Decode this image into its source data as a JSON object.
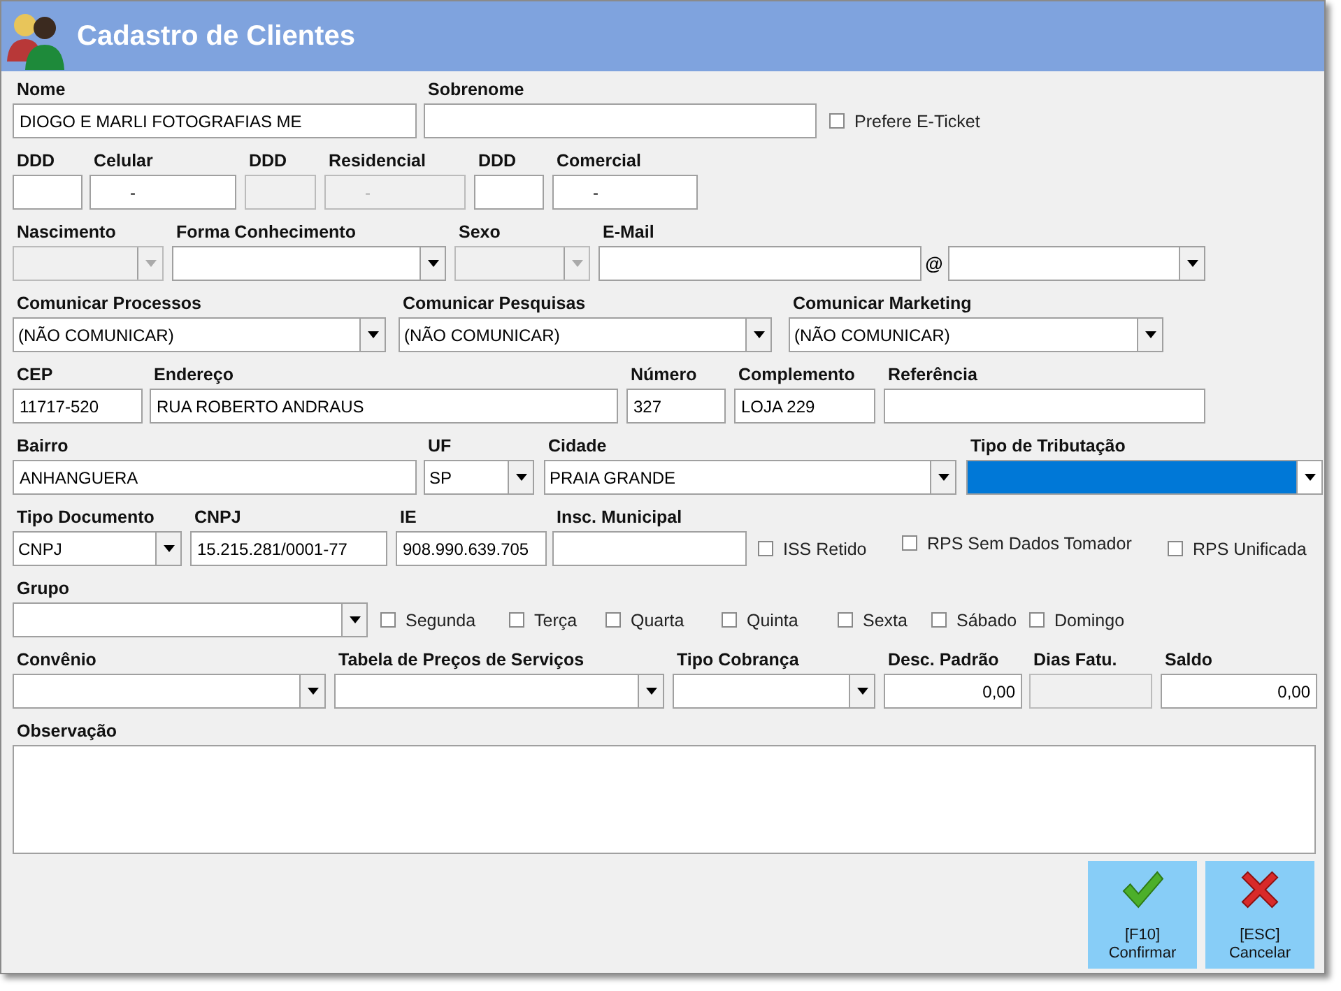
{
  "window": {
    "title": "Cadastro de Clientes"
  },
  "rows": [
    {
      "fields": [
        {
          "kind": "text",
          "label": "Nome",
          "value": "DIOGO E MARLI FOTOGRAFIAS ME",
          "disabled": false
        },
        {
          "kind": "text",
          "label": "Sobrenome",
          "disabled": false
        },
        {
          "kind": "check",
          "label": "Prefere E-Ticket",
          "checked": false
        }
      ]
    },
    {
      "fields": [
        {
          "kind": "text",
          "label": "DDD",
          "disabled": false
        },
        {
          "kind": "text",
          "label": "Celular",
          "value": "-",
          "disabled": false
        },
        {
          "kind": "text",
          "label": "DDD",
          "disabled": true
        },
        {
          "kind": "text",
          "label": "Residencial",
          "value": "-",
          "disabled": true
        },
        {
          "kind": "text",
          "label": "DDD",
          "disabled": false
        },
        {
          "kind": "text",
          "label": "Comercial",
          "value": "-",
          "disabled": false
        }
      ]
    },
    {
      "fields": [
        {
          "kind": "combo",
          "label": "Nascimento",
          "disabled": true,
          "highlighted": false
        },
        {
          "kind": "combo",
          "label": "Forma Conhecimento",
          "disabled": false,
          "highlighted": false
        },
        {
          "kind": "combo",
          "label": "Sexo",
          "disabled": true,
          "highlighted": false
        },
        {
          "kind": "text",
          "label": "E-Mail",
          "disabled": false
        },
        {
          "kind": "at",
          "label": "@"
        },
        {
          "kind": "combo",
          "disabled": false,
          "highlighted": false
        }
      ]
    },
    {
      "fields": [
        {
          "kind": "combo",
          "label": "Comunicar Processos",
          "value": "(NÃO COMUNICAR)",
          "disabled": false,
          "highlighted": false
        },
        {
          "kind": "combo",
          "label": "Comunicar Pesquisas",
          "value": "(NÃO COMUNICAR)",
          "disabled": false,
          "highlighted": false
        },
        {
          "kind": "combo",
          "label": "Comunicar Marketing",
          "value": "(NÃO COMUNICAR)",
          "disabled": false,
          "highlighted": false
        }
      ]
    },
    {
      "fields": [
        {
          "kind": "text",
          "label": "CEP",
          "value": "11717-520",
          "disabled": false
        },
        {
          "kind": "text",
          "label": "Endereço",
          "value": "RUA ROBERTO ANDRAUS",
          "disabled": false
        },
        {
          "kind": "text",
          "label": "Número",
          "value": "327",
          "disabled": false
        },
        {
          "kind": "text",
          "label": "Complemento",
          "value": "LOJA 229",
          "disabled": false
        },
        {
          "kind": "text",
          "label": "Referência",
          "disabled": false
        }
      ]
    },
    {
      "fields": [
        {
          "kind": "text",
          "label": "Bairro",
          "value": "ANHANGUERA",
          "disabled": false
        },
        {
          "kind": "combo",
          "label": "UF",
          "value": "SP",
          "disabled": false,
          "highlighted": false
        },
        {
          "kind": "combo",
          "label": "Cidade",
          "value": "PRAIA GRANDE",
          "disabled": false,
          "highlighted": false
        },
        {
          "kind": "combo",
          "label": "Tipo de Tributação",
          "disabled": false,
          "highlighted": true
        }
      ]
    },
    {
      "fields": [
        {
          "kind": "combo",
          "label": "Tipo Documento",
          "value": "CNPJ",
          "disabled": false,
          "highlighted": false
        },
        {
          "kind": "text",
          "label": "CNPJ",
          "value": "15.215.281/0001-77",
          "disabled": false
        },
        {
          "kind": "text",
          "label": "IE",
          "value": "908.990.639.705",
          "disabled": false
        },
        {
          "kind": "text",
          "label": "Insc. Municipal",
          "disabled": false
        },
        {
          "kind": "check",
          "label": "ISS Retido",
          "checked": false
        },
        {
          "kind": "check",
          "label": "RPS Sem Dados Tomador",
          "checked": false
        },
        {
          "kind": "check",
          "label": "RPS Unificada",
          "checked": false
        }
      ]
    },
    {
      "fields": [
        {
          "kind": "combo",
          "label": "Grupo",
          "disabled": false,
          "highlighted": false
        },
        {
          "kind": "check",
          "label": "Segunda",
          "checked": false
        },
        {
          "kind": "check",
          "label": "Terça",
          "checked": false
        },
        {
          "kind": "check",
          "label": "Quarta",
          "checked": false
        },
        {
          "kind": "check",
          "label": "Quinta",
          "checked": false
        },
        {
          "kind": "check",
          "label": "Sexta",
          "checked": false
        },
        {
          "kind": "check",
          "label": "Sábado",
          "checked": false
        },
        {
          "kind": "check",
          "label": "Domingo",
          "checked": false
        }
      ]
    },
    {
      "fields": [
        {
          "kind": "combo",
          "label": "Convênio",
          "disabled": false,
          "highlighted": false
        },
        {
          "kind": "combo",
          "label": "Tabela de Preços de Serviços",
          "disabled": false,
          "highlighted": false
        },
        {
          "kind": "combo",
          "label": "Tipo Cobrança",
          "disabled": false,
          "highlighted": false
        },
        {
          "kind": "text",
          "label": "Desc. Padrão",
          "value": "0,00",
          "disabled": false
        },
        {
          "kind": "text",
          "label": "Dias Fatu.",
          "disabled": true
        },
        {
          "kind": "text",
          "label": "Saldo",
          "value": "0,00",
          "disabled": false
        }
      ]
    },
    {
      "fields": [
        {
          "kind": "textarea",
          "label": "Observação"
        }
      ]
    }
  ],
  "buttons": [
    {
      "kind": "confirm",
      "key": "[F10]",
      "label": "Confirmar"
    },
    {
      "kind": "cancel",
      "key": "[ESC]",
      "label": "Cancelar"
    }
  ]
}
